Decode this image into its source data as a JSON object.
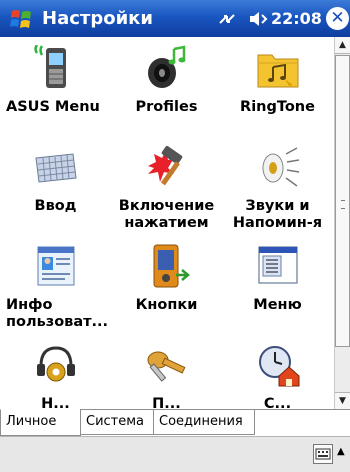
{
  "titlebar": {
    "title": "Настройки",
    "time": "22:08",
    "start_icon": "windows-flag-icon",
    "connectivity_icon": "connectivity-icon",
    "volume_icon": "volume-icon",
    "close_glyph": "✕"
  },
  "items": [
    {
      "label": "ASUS Menu",
      "icon": "asus-phone-icon"
    },
    {
      "label": "Profiles",
      "icon": "speaker-music-icon"
    },
    {
      "label": "RingTone",
      "icon": "ringtone-folder-icon"
    },
    {
      "label": "Ввод",
      "icon": "keyboard-icon"
    },
    {
      "label": "Включение\nнажатием",
      "icon": "hammer-icon"
    },
    {
      "label": "Звуки и\nНапомин-я",
      "icon": "sounds-speaker-icon"
    },
    {
      "label": "Инфо\nпользоват...",
      "icon": "owner-info-icon"
    },
    {
      "label": "Кнопки",
      "icon": "buttons-device-icon"
    },
    {
      "label": "Меню",
      "icon": "menu-window-icon"
    },
    {
      "label": "Н...",
      "icon": "gear-headset-icon"
    },
    {
      "label": "П...",
      "icon": "keys-icon"
    },
    {
      "label": "С...",
      "icon": "today-clock-house-icon"
    }
  ],
  "tabs": [
    {
      "label": "Личное",
      "active": true
    },
    {
      "label": "Система",
      "active": false
    },
    {
      "label": "Соединения",
      "active": false
    }
  ],
  "colors": {
    "titlebar": "#1a56c0",
    "tab_border": "#8e8e8e",
    "menubar": "#e7e7e7"
  }
}
